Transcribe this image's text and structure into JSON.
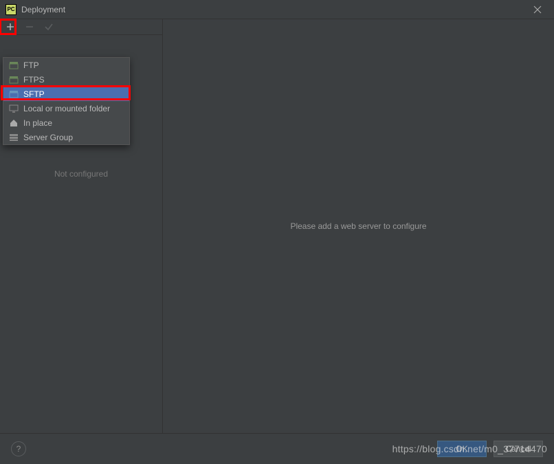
{
  "titlebar": {
    "appIconText": "PC",
    "title": "Deployment"
  },
  "dropdown": {
    "items": [
      {
        "label": "FTP",
        "iconColor": "#6a8759",
        "selected": false
      },
      {
        "label": "FTPS",
        "iconColor": "#6a8759",
        "selected": false
      },
      {
        "label": "SFTP",
        "iconColor": "#6897bb",
        "selected": true
      },
      {
        "label": "Local or mounted folder",
        "iconColor": "#888888",
        "selected": false
      },
      {
        "label": "In place",
        "iconColor": "#aaaaaa",
        "selected": false
      },
      {
        "label": "Server Group",
        "iconColor": "#888888",
        "selected": false
      }
    ]
  },
  "sidebar": {
    "notConfigured": "Not configured"
  },
  "main": {
    "message": "Please add a web server to configure"
  },
  "footer": {
    "helpLabel": "?",
    "okLabel": "OK",
    "cancelLabel": "Cancel"
  },
  "watermark": "https://blog.csdn.net/m0_37714470"
}
